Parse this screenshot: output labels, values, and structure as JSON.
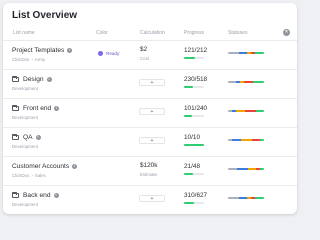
{
  "title": "List Overview",
  "columns": {
    "name": "List name",
    "color": "Color",
    "calculation": "Calculation",
    "progress": "Progress",
    "statuses": "Statuses"
  },
  "close_icon": "close-icon",
  "colors": {
    "ready_dot": "#7b68ee",
    "progress_fill": "#2ecd6f",
    "status_segments": [
      "#a9b0ba",
      "#3b7ddd",
      "#f0a500",
      "#e8453c",
      "#2ecd6f"
    ]
  },
  "rows": [
    {
      "name": "Project Templates",
      "folder": false,
      "sub": [
        "ClickDos",
        "Army"
      ],
      "color_label": "Ready",
      "calc_value": "$2",
      "calc_sub": "Cost",
      "progress": "121/212",
      "progress_ratio": 0.57
    },
    {
      "name": "Design",
      "folder": true,
      "sub": [
        "Development"
      ],
      "color_label": "",
      "calc_value": "+",
      "calc_sub": "",
      "progress": "230/518",
      "progress_ratio": 0.44
    },
    {
      "name": "Front end",
      "folder": true,
      "sub": [
        "Development"
      ],
      "color_label": "",
      "calc_value": "+",
      "calc_sub": "",
      "progress": "101/240",
      "progress_ratio": 0.42
    },
    {
      "name": "QA",
      "folder": true,
      "sub": [
        "Development"
      ],
      "color_label": "",
      "calc_value": "+",
      "calc_sub": "",
      "progress": "10/10",
      "progress_ratio": 1.0
    },
    {
      "name": "Customer Accounts",
      "folder": false,
      "sub": [
        "ClickDos",
        "Sales"
      ],
      "color_label": "",
      "calc_value": "$120k",
      "calc_sub": "Estimate",
      "progress": "21/48",
      "progress_ratio": 0.44
    },
    {
      "name": "Back end",
      "folder": true,
      "sub": [
        "Development"
      ],
      "color_label": "",
      "calc_value": "+",
      "calc_sub": "",
      "progress": "310/627",
      "progress_ratio": 0.49
    }
  ]
}
